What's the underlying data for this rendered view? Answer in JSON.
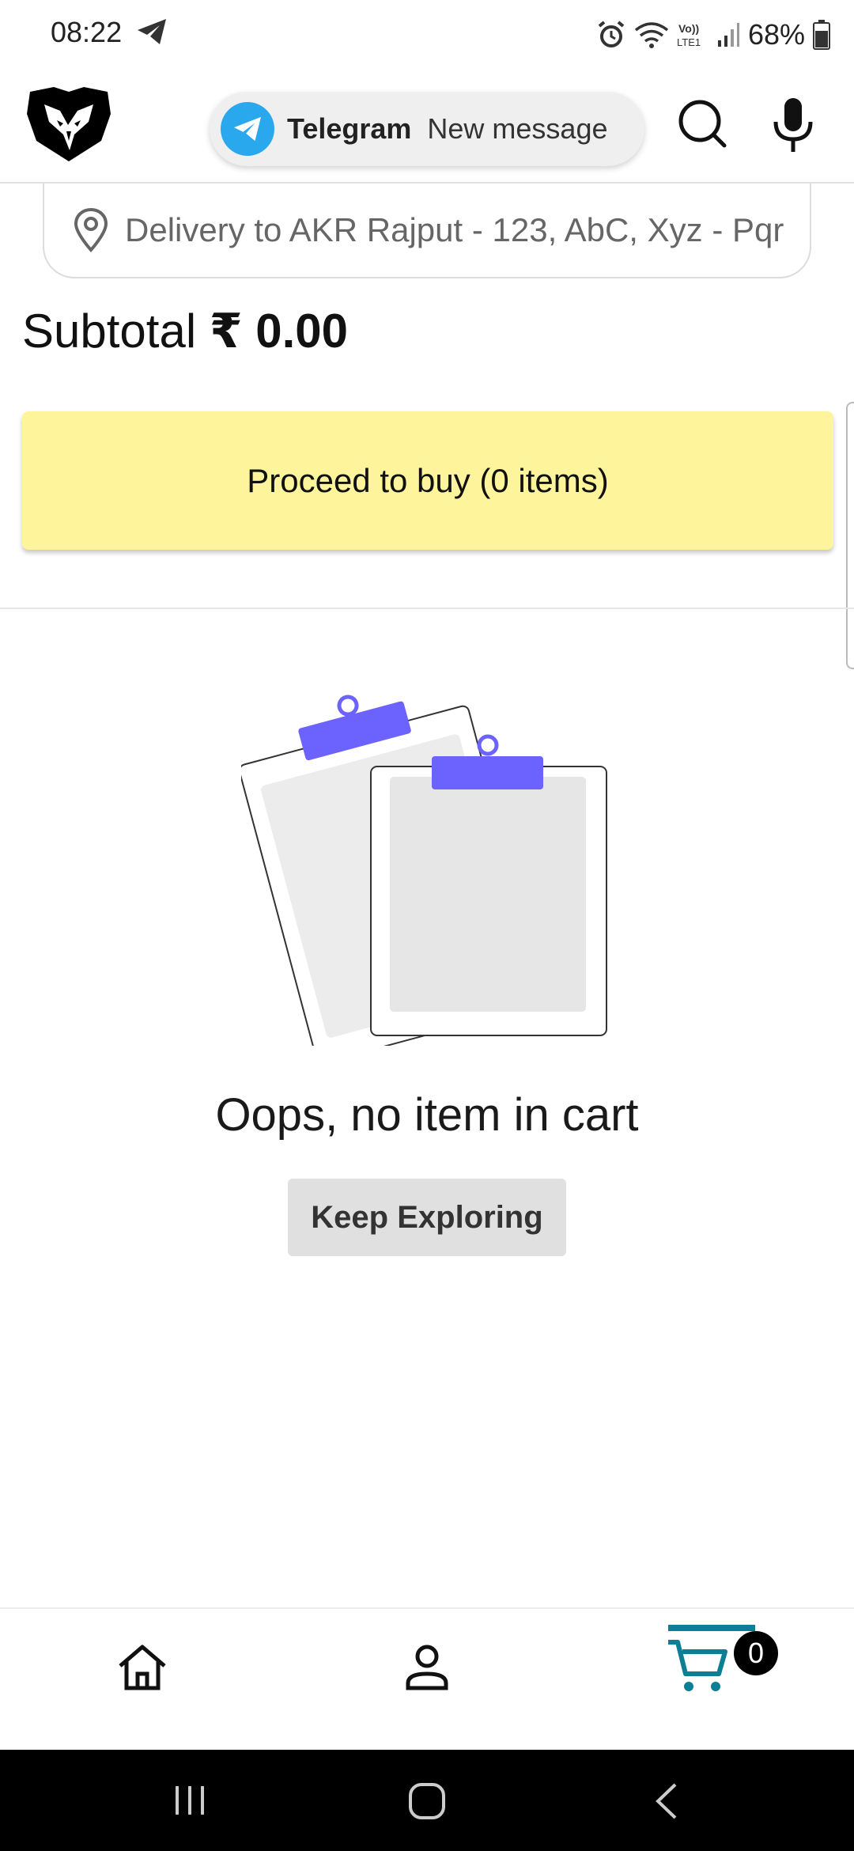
{
  "status_bar": {
    "time": "08:22",
    "battery": "68%",
    "icons": [
      "telegram-icon",
      "alarm-icon",
      "wifi-icon",
      "volte-icon",
      "signal-icon",
      "battery-icon"
    ]
  },
  "header": {
    "logo": "wolf-logo",
    "notification": {
      "app": "Telegram",
      "message": "New message"
    },
    "icons": [
      "search-icon",
      "mic-icon"
    ]
  },
  "delivery": {
    "text": "Delivery to AKR Rajput - 123, AbC, Xyz - Pqr"
  },
  "subtotal": {
    "label": "Subtotal",
    "currency": "₹",
    "amount": "0.00"
  },
  "proceed_button": {
    "label": "Proceed to buy (0 items)"
  },
  "empty_state": {
    "message": "Oops, no item in cart",
    "button_label": "Keep Exploring",
    "illustration": "clipboards-illustration"
  },
  "bottom_nav": {
    "items": [
      "home-icon",
      "profile-icon",
      "cart-icon"
    ],
    "cart_count": "0",
    "active_color": "#0d7f94"
  },
  "colors": {
    "proceed_bg": "#fdf49c",
    "accent_purple": "#6c63ff",
    "telegram_blue": "#2aa8ee"
  }
}
